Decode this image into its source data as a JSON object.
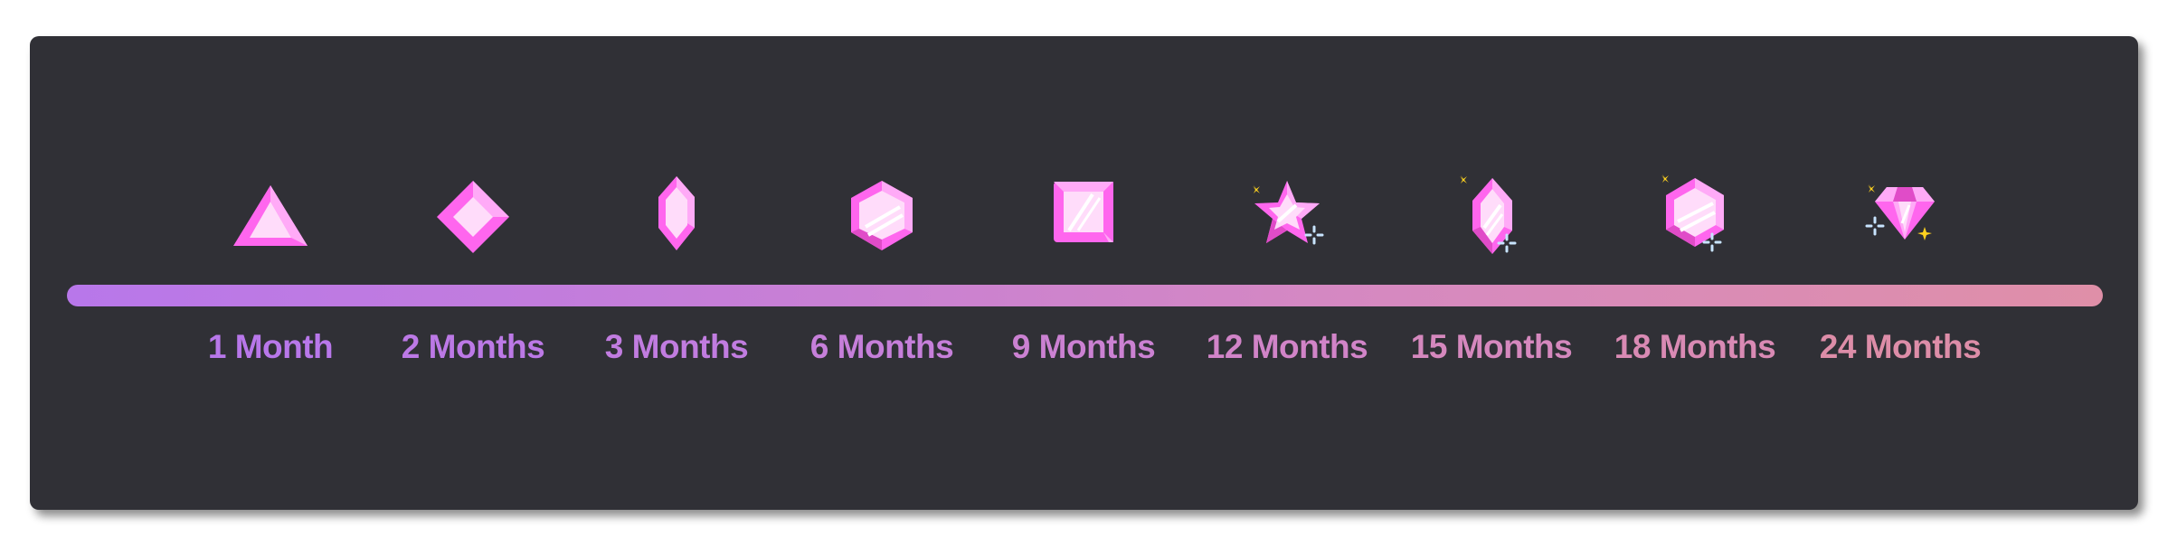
{
  "timeline": {
    "bar_gradient": [
      "#b877ea",
      "#c77fd6",
      "#d689c0",
      "#df8fa8"
    ],
    "milestones": [
      {
        "label": "1 Month",
        "icon": "triangle-gem-icon",
        "color": "#b877ea",
        "sparkles": false
      },
      {
        "label": "2 Months",
        "icon": "diamond-square-gem-icon",
        "color": "#bc79e6",
        "sparkles": false
      },
      {
        "label": "3 Months",
        "icon": "hexagonal-crystal-gem-icon",
        "color": "#c17ce0",
        "sparkles": false
      },
      {
        "label": "6 Months",
        "icon": "hexagon-gem-icon",
        "color": "#c67fda",
        "sparkles": false
      },
      {
        "label": "9 Months",
        "icon": "square-gem-icon",
        "color": "#cb81d2",
        "sparkles": false
      },
      {
        "label": "12 Months",
        "icon": "star-gem-icon",
        "color": "#d184c8",
        "sparkles": true
      },
      {
        "label": "15 Months",
        "icon": "hexagonal-crystal-gem-sparkle-icon",
        "color": "#d588be",
        "sparkles": true
      },
      {
        "label": "18 Months",
        "icon": "hexagon-gem-sparkle-icon",
        "color": "#d98ab4",
        "sparkles": true
      },
      {
        "label": "24 Months",
        "icon": "diamond-gem-sparkle-icon",
        "color": "#dd8da8",
        "sparkles": true
      }
    ]
  },
  "colors": {
    "panel_bg": "#303036",
    "gem_main": "#ff66ee",
    "gem_light": "#ffaaf7",
    "gem_face": "#ffdcfa",
    "gem_dark": "#e04cc8",
    "sparkle_yellow": "#ffd21f",
    "sparkle_blue": "#c8e4ff"
  }
}
